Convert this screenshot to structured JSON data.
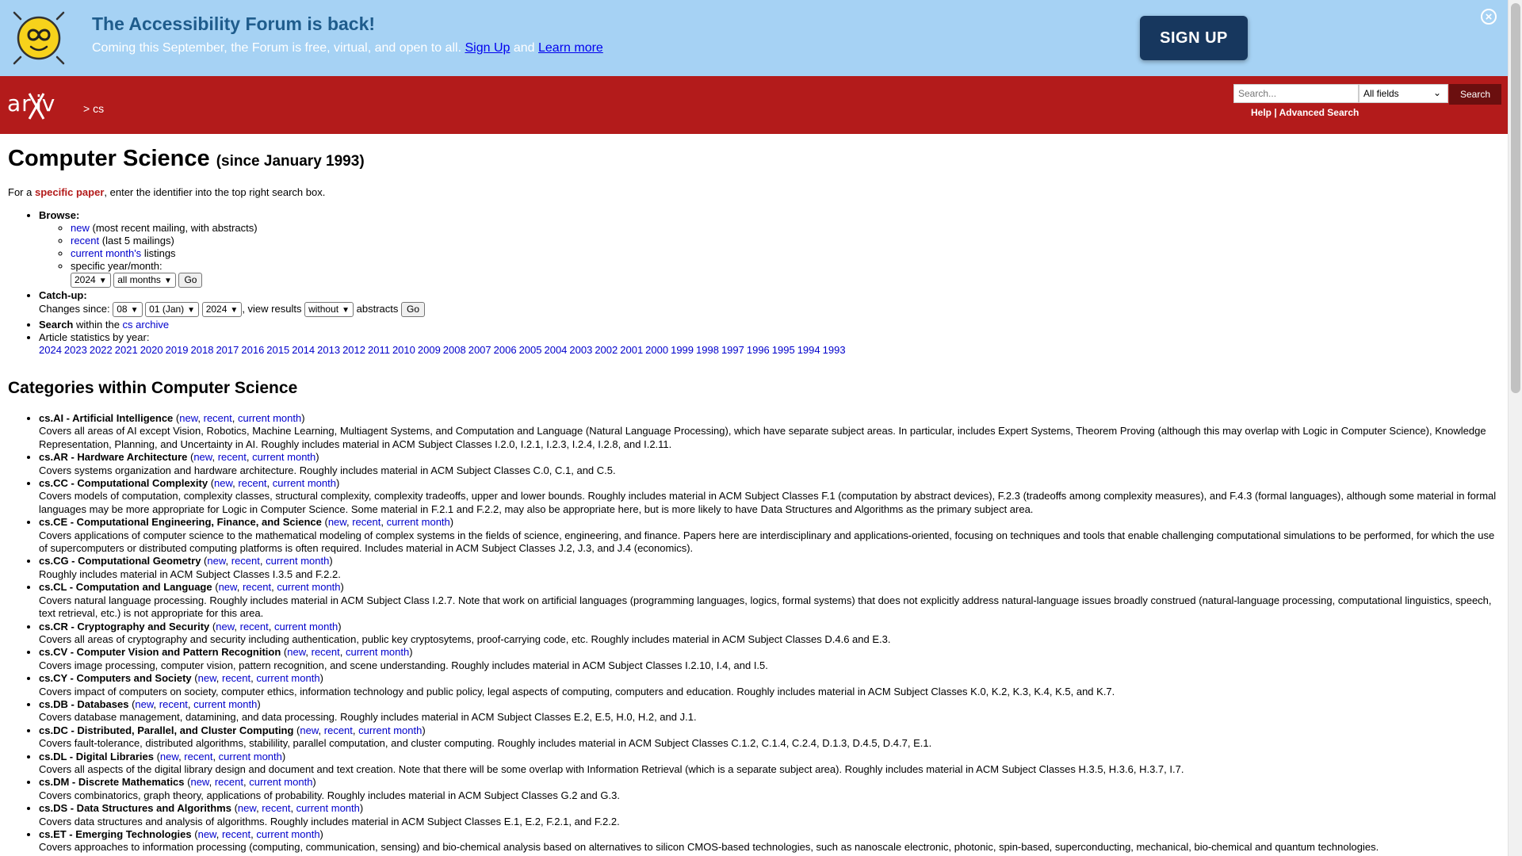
{
  "banner": {
    "title": "The Accessibility Forum is back!",
    "subtitle": "Coming this September, the Forum is free, virtual, and open to all.",
    "signup_link": "Sign Up",
    "and": "and",
    "learn_more": "Learn more",
    "signup_button": "SIGN UP",
    "close_icon": "⊗"
  },
  "header": {
    "logo_text": "arXiv",
    "breadcrumb": "> cs",
    "search_placeholder": "Search...",
    "field_select": "All fields",
    "search_button": "Search",
    "help": "Help",
    "separator": "|",
    "advanced_search": "Advanced Search"
  },
  "page": {
    "title": "Computer Science",
    "since": "(since January 1993)",
    "intro_pre": "For a",
    "intro_bold": "specific paper",
    "intro_post": ", enter the identifier into the top right search box."
  },
  "browse": {
    "label": "Browse:",
    "items": [
      {
        "link": "new",
        "text": "(most recent mailing, with abstracts)"
      },
      {
        "link": "recent",
        "text": "(last 5 mailings)"
      },
      {
        "link": "current month's",
        "text": "listings"
      }
    ],
    "specific": "specific year/month:",
    "year_select": "2024",
    "month_select": "all months",
    "go": "Go"
  },
  "catchup": {
    "label": "Catch-up:",
    "changes_since": "Changes since:",
    "day": "08",
    "month": "01 (Jan)",
    "year": "2024",
    "view_results": ", view results",
    "abstracts_select": "without",
    "abstracts": "abstracts",
    "go": "Go"
  },
  "search_within": {
    "label": "Search",
    "within": "within the",
    "link": "cs archive"
  },
  "stats": {
    "label": "Article statistics by year:",
    "years": [
      "2024",
      "2023",
      "2022",
      "2021",
      "2020",
      "2019",
      "2018",
      "2017",
      "2016",
      "2015",
      "2014",
      "2013",
      "2012",
      "2011",
      "2010",
      "2009",
      "2008",
      "2007",
      "2006",
      "2005",
      "2004",
      "2003",
      "2002",
      "2001",
      "2000",
      "1999",
      "1998",
      "1997",
      "1996",
      "1995",
      "1994",
      "1993"
    ]
  },
  "categories_heading": "Categories within Computer Science",
  "link_labels": {
    "new": "new",
    "recent": "recent",
    "current": "current month"
  },
  "categories": [
    {
      "title": "cs.AI - Artificial Intelligence",
      "desc": "Covers all areas of AI except Vision, Robotics, Machine Learning, Multiagent Systems, and Computation and Language (Natural Language Processing), which have separate subject areas. In particular, includes Expert Systems, Theorem Proving (although this may overlap with Logic in Computer Science), Knowledge Representation, Planning, and Uncertainty in AI. Roughly includes material in ACM Subject Classes I.2.0, I.2.1, I.2.3, I.2.4, I.2.8, and I.2.11."
    },
    {
      "title": "cs.AR - Hardware Architecture",
      "desc": "Covers systems organization and hardware architecture. Roughly includes material in ACM Subject Classes C.0, C.1, and C.5."
    },
    {
      "title": "cs.CC - Computational Complexity",
      "desc": "Covers models of computation, complexity classes, structural complexity, complexity tradeoffs, upper and lower bounds. Roughly includes material in ACM Subject Classes F.1 (computation by abstract devices), F.2.3 (tradeoffs among complexity measures), and F.4.3 (formal languages), although some material in formal languages may be more appropriate for Logic in Computer Science. Some material in F.2.1 and F.2.2, may also be appropriate here, but is more likely to have Data Structures and Algorithms as the primary subject area."
    },
    {
      "title": "cs.CE - Computational Engineering, Finance, and Science",
      "desc": "Covers applications of computer science to the mathematical modeling of complex systems in the fields of science, engineering, and finance. Papers here are interdisciplinary and applications-oriented, focusing on techniques and tools that enable challenging computational simulations to be performed, for which the use of supercomputers or distributed computing platforms is often required. Includes material in ACM Subject Classes J.2, J.3, and J.4 (economics)."
    },
    {
      "title": "cs.CG - Computational Geometry",
      "desc": "Roughly includes material in ACM Subject Classes I.3.5 and F.2.2."
    },
    {
      "title": "cs.CL - Computation and Language",
      "desc": "Covers natural language processing. Roughly includes material in ACM Subject Class I.2.7. Note that work on artificial languages (programming languages, logics, formal systems) that does not explicitly address natural-language issues broadly construed (natural-language processing, computational linguistics, speech, text retrieval, etc.) is not appropriate for this area."
    },
    {
      "title": "cs.CR - Cryptography and Security",
      "desc": "Covers all areas of cryptography and security including authentication, public key cryptosytems, proof-carrying code, etc. Roughly includes material in ACM Subject Classes D.4.6 and E.3."
    },
    {
      "title": "cs.CV - Computer Vision and Pattern Recognition",
      "desc": "Covers image processing, computer vision, pattern recognition, and scene understanding. Roughly includes material in ACM Subject Classes I.2.10, I.4, and I.5."
    },
    {
      "title": "cs.CY - Computers and Society",
      "desc": "Covers impact of computers on society, computer ethics, information technology and public policy, legal aspects of computing, computers and education. Roughly includes material in ACM Subject Classes K.0, K.2, K.3, K.4, K.5, and K.7."
    },
    {
      "title": "cs.DB - Databases",
      "desc": "Covers database management, datamining, and data processing. Roughly includes material in ACM Subject Classes E.2, E.5, H.0, H.2, and J.1."
    },
    {
      "title": "cs.DC - Distributed, Parallel, and Cluster Computing",
      "desc": "Covers fault-tolerance, distributed algorithms, stabilility, parallel computation, and cluster computing. Roughly includes material in ACM Subject Classes C.1.2, C.1.4, C.2.4, D.1.3, D.4.5, D.4.7, E.1."
    },
    {
      "title": "cs.DL - Digital Libraries",
      "desc": "Covers all aspects of the digital library design and document and text creation. Note that there will be some overlap with Information Retrieval (which is a separate subject area). Roughly includes material in ACM Subject Classes H.3.5, H.3.6, H.3.7, I.7."
    },
    {
      "title": "cs.DM - Discrete Mathematics",
      "desc": "Covers combinatorics, graph theory, applications of probability. Roughly includes material in ACM Subject Classes G.2 and G.3."
    },
    {
      "title": "cs.DS - Data Structures and Algorithms",
      "desc": "Covers data structures and analysis of algorithms. Roughly includes material in ACM Subject Classes E.1, E.2, F.2.1, and F.2.2."
    },
    {
      "title": "cs.ET - Emerging Technologies",
      "desc": "Covers approaches to information processing (computing, communication, sensing) and bio-chemical analysis based on alternatives to silicon CMOS-based technologies, such as nanoscale electronic, photonic, spin-based, superconducting, mechanical, bio-chemical and quantum technologies."
    }
  ]
}
